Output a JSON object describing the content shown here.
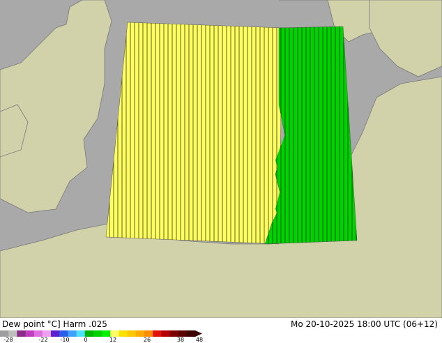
{
  "header": {
    "left_title": "Dew point °C] Harm .025",
    "right_title": "Mo 20-10-2025 18:00 UTC (06+12)"
  },
  "legend": {
    "ticks": [
      "-28",
      "-22",
      "-10",
      "0",
      "12",
      "26",
      "38",
      "48"
    ],
    "colors": [
      "#9e9e9e",
      "#bdbdbd",
      "#8a2c8a",
      "#c23cc2",
      "#e070e0",
      "#ef9fef",
      "#5a1fd0",
      "#2c5fe8",
      "#3f9fff",
      "#4fdfff",
      "#00b400",
      "#00d200",
      "#00f000",
      "#ffff64",
      "#ffe100",
      "#ffc800",
      "#ffaa00",
      "#ff8c00",
      "#e11400",
      "#b40000",
      "#7d0000",
      "#5a0000",
      "#3c0000"
    ]
  },
  "map": {
    "land_color": "#d2d2aa",
    "sea_color": "#a9a9a9",
    "field_colors": {
      "warm": "#ffff64",
      "cool": "#00d200"
    }
  }
}
